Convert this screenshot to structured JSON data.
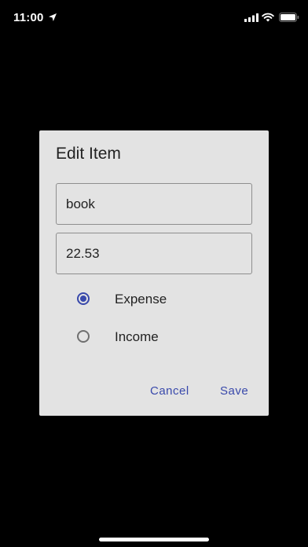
{
  "status_bar": {
    "time": "11:00"
  },
  "dialog": {
    "title": "Edit Item",
    "name_value": "book",
    "amount_value": "22.53",
    "options": [
      {
        "label": "Expense",
        "selected": true
      },
      {
        "label": "Income",
        "selected": false
      }
    ],
    "cancel_label": "Cancel",
    "save_label": "Save"
  },
  "colors": {
    "background": "#000000",
    "dialog_background": "#e3e3e3",
    "accent": "#3949ab",
    "text": "#222222"
  },
  "icons": [
    "location-arrow-icon",
    "cellular-signal-icon",
    "wifi-icon",
    "battery-icon"
  ]
}
